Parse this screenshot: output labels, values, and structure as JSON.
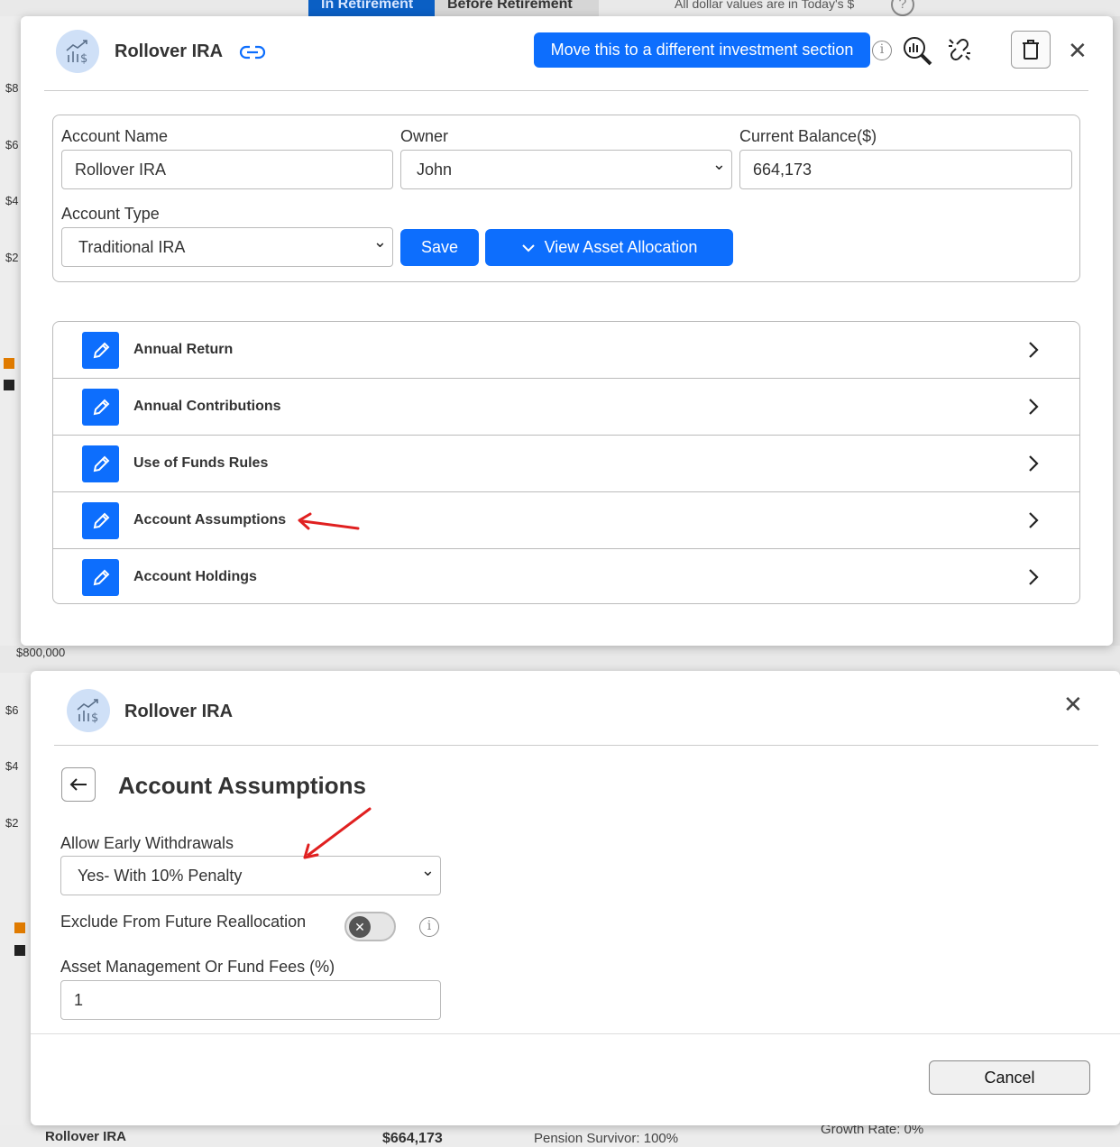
{
  "background": {
    "tabs": [
      "In Retirement",
      "Before Retirement"
    ],
    "note": "All dollar values are in Today's $",
    "help": "?",
    "axis_left": [
      "$8",
      "$6",
      "$4",
      "$2"
    ],
    "axis_left_2": [
      "$6",
      "$4",
      "$2"
    ],
    "mid_text": "$800,000",
    "bottom": {
      "account_name": "Rollover IRA",
      "amount": "$664,173",
      "pension": "Pension Survivor: 100%",
      "growth": "Growth Rate: 0%"
    },
    "colors": {
      "legend_orange": "#e07b00",
      "legend_black": "#222222"
    }
  },
  "modal1": {
    "title": "Rollover IRA",
    "move_button": "Move this to a different investment section",
    "info_icon": "i",
    "form": {
      "account_name_label": "Account Name",
      "account_name_value": "Rollover IRA",
      "owner_label": "Owner",
      "owner_value": "John",
      "balance_label": "Current Balance($)",
      "balance_value": "664,173",
      "account_type_label": "Account Type",
      "account_type_value": "Traditional IRA",
      "save_label": "Save",
      "view_allocation_label": "View Asset Allocation"
    },
    "list": [
      {
        "label": "Annual Return"
      },
      {
        "label": "Annual Contributions"
      },
      {
        "label": "Use of Funds Rules"
      },
      {
        "label": "Account Assumptions"
      },
      {
        "label": "Account Holdings"
      }
    ]
  },
  "modal2": {
    "title": "Rollover IRA",
    "section_title": "Account Assumptions",
    "early_withdrawals_label": "Allow Early Withdrawals",
    "early_withdrawals_value": "Yes- With 10% Penalty",
    "exclude_label": "Exclude From Future Reallocation",
    "info_icon": "i",
    "fees_label": "Asset Management Or Fund Fees (%)",
    "fees_value": "1",
    "cancel_label": "Cancel"
  },
  "colors": {
    "primary": "#0d6efd",
    "annotation_arrow": "#e02020",
    "avatar_bg": "#cfe0f7"
  }
}
